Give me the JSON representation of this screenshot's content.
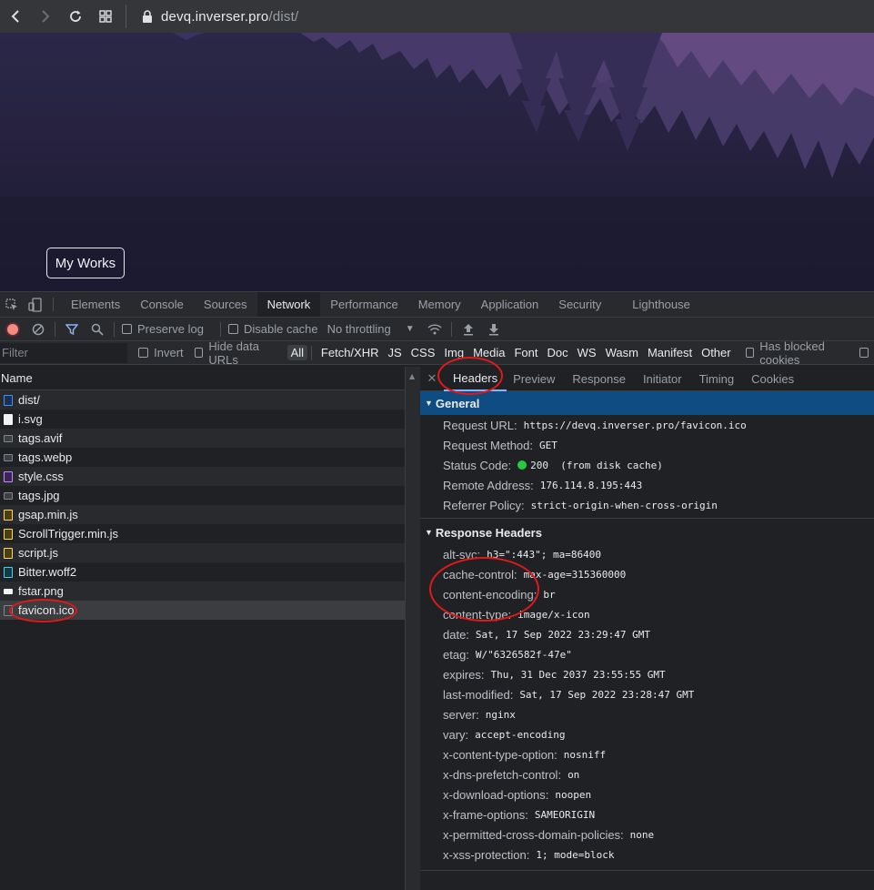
{
  "browser": {
    "url_host": "devq.inverser.pro",
    "url_path": "/dist/"
  },
  "page": {
    "button_label": "My Works"
  },
  "devtools": {
    "tabs": [
      "Elements",
      "Console",
      "Sources",
      "Network",
      "Performance",
      "Memory",
      "Application",
      "Security",
      "Lighthouse"
    ],
    "active_tab": "Network",
    "toolbar": {
      "preserve_log": "Preserve log",
      "disable_cache": "Disable cache",
      "throttling": "No throttling"
    },
    "filter": {
      "placeholder": "Filter",
      "invert": "Invert",
      "hide_data_urls": "Hide data URLs",
      "types": [
        "All",
        "Fetch/XHR",
        "JS",
        "CSS",
        "Img",
        "Media",
        "Font",
        "Doc",
        "WS",
        "Wasm",
        "Manifest",
        "Other"
      ],
      "has_blocked_cookies": "Has blocked cookies"
    },
    "requests": {
      "column": "Name",
      "items": [
        {
          "name": "dist/",
          "type": "doc"
        },
        {
          "name": "i.svg",
          "type": "svg"
        },
        {
          "name": "tags.avif",
          "type": "img"
        },
        {
          "name": "tags.webp",
          "type": "img"
        },
        {
          "name": "style.css",
          "type": "css"
        },
        {
          "name": "tags.jpg",
          "type": "img"
        },
        {
          "name": "gsap.min.js",
          "type": "js"
        },
        {
          "name": "ScrollTrigger.min.js",
          "type": "js"
        },
        {
          "name": "script.js",
          "type": "js"
        },
        {
          "name": "Bitter.woff2",
          "type": "font"
        },
        {
          "name": "fstar.png",
          "type": "png"
        },
        {
          "name": "favicon.ico",
          "type": "ico"
        }
      ]
    },
    "details": {
      "tabs": [
        "Headers",
        "Preview",
        "Response",
        "Initiator",
        "Timing",
        "Cookies"
      ],
      "general_title": "General",
      "general": [
        {
          "k": "Request URL:",
          "v": "https://devq.inverser.pro/favicon.ico"
        },
        {
          "k": "Request Method:",
          "v": "GET"
        },
        {
          "k": "Status Code:",
          "v": "200  (from disk cache)"
        },
        {
          "k": "Remote Address:",
          "v": "176.114.8.195:443"
        },
        {
          "k": "Referrer Policy:",
          "v": "strict-origin-when-cross-origin"
        }
      ],
      "response_title": "Response Headers",
      "response": [
        {
          "k": "alt-svc:",
          "v": "h3=\":443\"; ma=86400"
        },
        {
          "k": "cache-control:",
          "v": "max-age=315360000"
        },
        {
          "k": "content-encoding:",
          "v": "br"
        },
        {
          "k": "content-type:",
          "v": "image/x-icon"
        },
        {
          "k": "date:",
          "v": "Sat, 17 Sep 2022 23:29:47 GMT"
        },
        {
          "k": "etag:",
          "v": "W/\"6326582f-47e\""
        },
        {
          "k": "expires:",
          "v": "Thu, 31 Dec 2037 23:55:55 GMT"
        },
        {
          "k": "last-modified:",
          "v": "Sat, 17 Sep 2022 23:28:47 GMT"
        },
        {
          "k": "server:",
          "v": "nginx"
        },
        {
          "k": "vary:",
          "v": "accept-encoding"
        },
        {
          "k": "x-content-type-option:",
          "v": "nosniff"
        },
        {
          "k": "x-dns-prefetch-control:",
          "v": "on"
        },
        {
          "k": "x-download-options:",
          "v": "noopen"
        },
        {
          "k": "x-frame-options:",
          "v": "SAMEORIGIN"
        },
        {
          "k": "x-permitted-cross-domain-policies:",
          "v": "none"
        },
        {
          "k": "x-xss-protection:",
          "v": "1; mode=block"
        }
      ]
    }
  },
  "colors": {
    "accent": "#8ab4f8",
    "selected_section": "#0f4c81",
    "annotation_ring": "#e01a1a",
    "status_ok": "#28c840"
  }
}
